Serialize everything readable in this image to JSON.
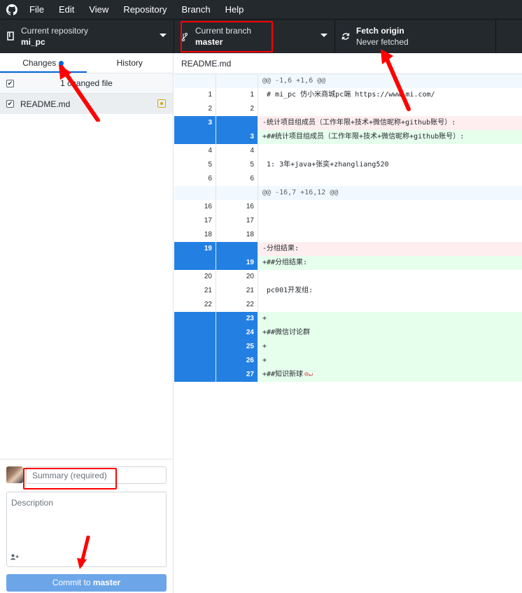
{
  "app": {
    "menu": [
      "File",
      "Edit",
      "View",
      "Repository",
      "Branch",
      "Help"
    ]
  },
  "toolbar": {
    "repo": {
      "label": "Current repository",
      "value": "mi_pc"
    },
    "branch": {
      "label": "Current branch",
      "value": "master"
    },
    "fetch": {
      "label": "Fetch origin",
      "status": "Never fetched"
    }
  },
  "sidebar": {
    "tabs": [
      {
        "label": "Changes",
        "active": true
      },
      {
        "label": "History",
        "active": false
      }
    ],
    "changed_count_label": "1 changed file",
    "files": [
      {
        "name": "README.md",
        "status": "modified"
      }
    ]
  },
  "commit": {
    "summary_placeholder": "Summary (required)",
    "description_placeholder": "Description",
    "button_prefix": "Commit to ",
    "button_branch": "master"
  },
  "diff": {
    "filename": "README.md",
    "lines": [
      {
        "type": "hunk",
        "old": "",
        "new": "",
        "text": "@@ -1,6 +1,6 @@"
      },
      {
        "type": "ctx",
        "old": "1",
        "new": "1",
        "text": " # mi_pc 仿小米商城pc端 https://www.mi.com/"
      },
      {
        "type": "ctx",
        "old": "2",
        "new": "2",
        "text": ""
      },
      {
        "type": "del",
        "old": "3",
        "new": "",
        "text": "-统计项目组成员（工作年限+技术+微信昵称+github账号）:"
      },
      {
        "type": "add",
        "old": "",
        "new": "3",
        "text": "+##统计项目组成员（工作年限+技术+微信昵称+github账号）:"
      },
      {
        "type": "ctx",
        "old": "4",
        "new": "4",
        "text": ""
      },
      {
        "type": "ctx",
        "old": "5",
        "new": "5",
        "text": " 1: 3年+java+张奕+zhangliang520"
      },
      {
        "type": "ctx",
        "old": "6",
        "new": "6",
        "text": ""
      },
      {
        "type": "hunk",
        "old": "",
        "new": "",
        "text": "@@ -16,7 +16,12 @@"
      },
      {
        "type": "ctx",
        "old": "16",
        "new": "16",
        "text": ""
      },
      {
        "type": "ctx",
        "old": "17",
        "new": "17",
        "text": ""
      },
      {
        "type": "ctx",
        "old": "18",
        "new": "18",
        "text": ""
      },
      {
        "type": "del",
        "old": "19",
        "new": "",
        "text": "-分组结果:"
      },
      {
        "type": "add",
        "old": "",
        "new": "19",
        "text": "+##分组结果:"
      },
      {
        "type": "ctx",
        "old": "20",
        "new": "20",
        "text": ""
      },
      {
        "type": "ctx",
        "old": "21",
        "new": "21",
        "text": " pc001开发组:"
      },
      {
        "type": "ctx",
        "old": "22",
        "new": "22",
        "text": ""
      },
      {
        "type": "add",
        "old": "",
        "new": "23",
        "text": "+"
      },
      {
        "type": "add",
        "old": "",
        "new": "24",
        "text": "+##微信讨论群"
      },
      {
        "type": "add",
        "old": "",
        "new": "25",
        "text": "+"
      },
      {
        "type": "add",
        "old": "",
        "new": "26",
        "text": "+"
      },
      {
        "type": "add",
        "old": "",
        "new": "27",
        "text": "+##知识新球",
        "noeol": "⊘↵"
      }
    ]
  },
  "colors": {
    "titlebar": "#24292e",
    "accent": "#0366d6",
    "gutter_changed": "#2380e2",
    "added_bg": "#e6ffed",
    "removed_bg": "#ffeef0",
    "annotation": "#ff0000"
  }
}
